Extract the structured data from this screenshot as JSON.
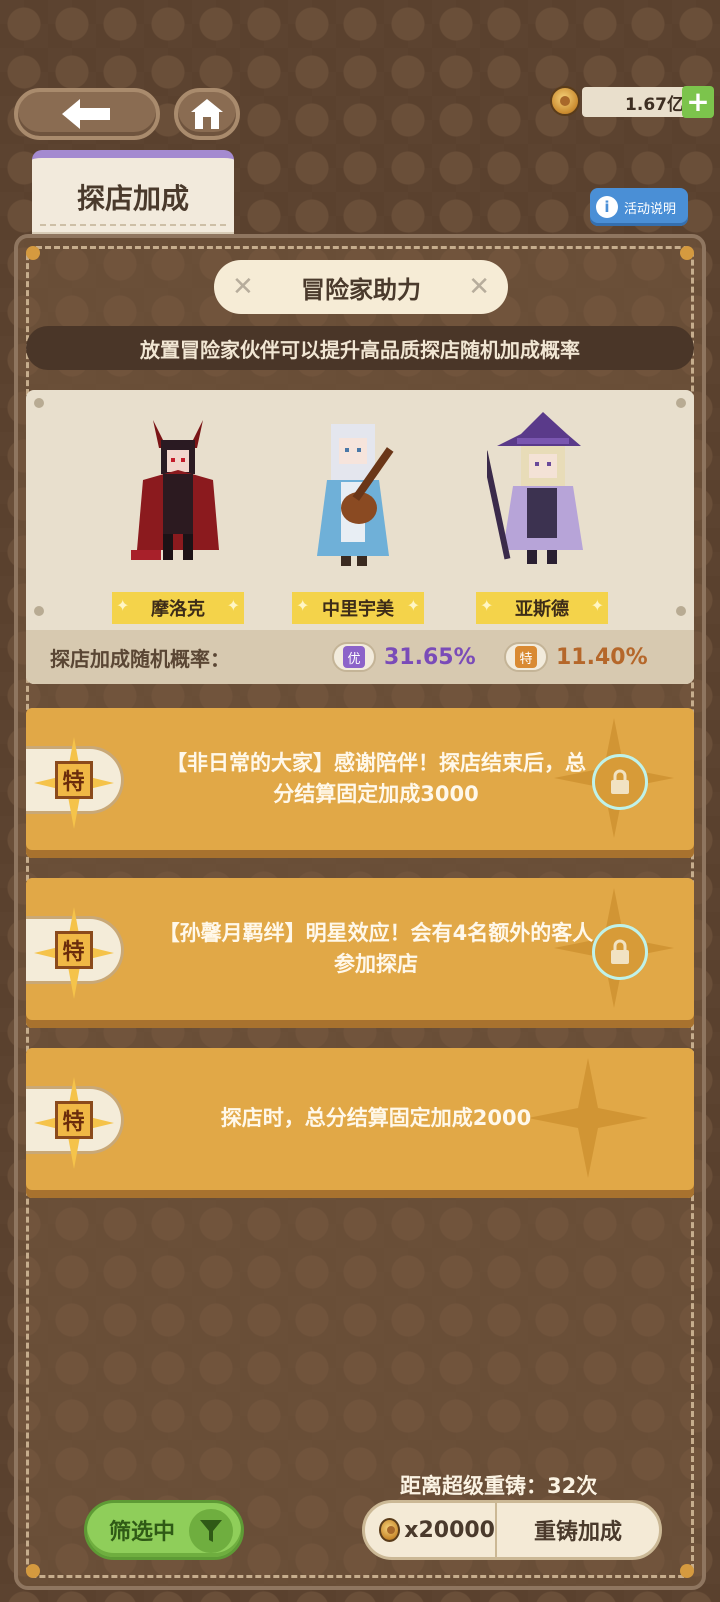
{
  "currency": {
    "amount": "1.67亿",
    "add_label": "+"
  },
  "tab": {
    "label": "探店加成"
  },
  "help": {
    "icon_text": "i",
    "label": "活动说明"
  },
  "section": {
    "title": "冒险家助力",
    "subtitle": "放置冒险家伙伴可以提升高品质探店随机加成概率"
  },
  "heroes": [
    {
      "name": "摩洛克",
      "icon": "demon-character"
    },
    {
      "name": "中里宇美",
      "icon": "bard-character"
    },
    {
      "name": "亚斯德",
      "icon": "witch-character"
    }
  ],
  "probability": {
    "label": "探店加成随机概率：",
    "items": [
      {
        "badge": "优",
        "value": "31.65%",
        "color": "#7a4bb8",
        "badge_color": "#8c63c9"
      },
      {
        "badge": "特",
        "value": "11.40%",
        "color": "#b5672a",
        "badge_color": "#d98a33"
      }
    ]
  },
  "bonuses": [
    {
      "tag": "特",
      "text": "【非日常的大家】感谢陪伴！探店结束后，总分结算固定加成3000",
      "locked": true
    },
    {
      "tag": "特",
      "text": "【孙馨月羁绊】明星效应！会有4名额外的客人参加探店",
      "locked": true
    },
    {
      "tag": "特",
      "text": "探店时，总分结算固定加成2000",
      "locked": false
    }
  ],
  "reforge": {
    "remaining": "距离超级重铸：32次",
    "cost": "x20000",
    "label": "重铸加成"
  },
  "filter": {
    "label": "筛选中"
  },
  "colors": {
    "accent_green": "#8fce5a",
    "panel_gold": "#e1a847",
    "help_blue": "#4a8fd6"
  }
}
